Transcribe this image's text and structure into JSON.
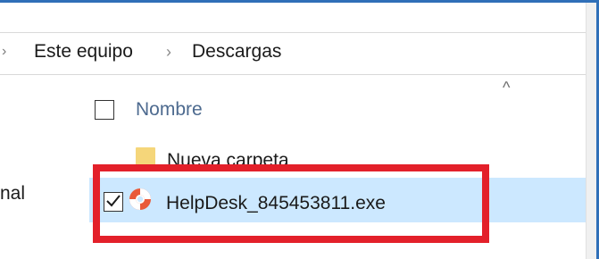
{
  "address_bar": {
    "crumbs": [
      "Este equipo",
      "Descargas"
    ],
    "separator_glyph": "›"
  },
  "nav_pane": {
    "partial_label": "nal"
  },
  "file_list": {
    "column_header": "Nombre",
    "sort_indicator": "^",
    "items": [
      {
        "name": "Nueva carpeta",
        "icon": "folder-icon",
        "selected": false
      },
      {
        "name": "HelpDesk_845453811.exe",
        "icon": "lifebuoy-icon",
        "selected": true,
        "checked": true
      }
    ]
  },
  "colors": {
    "window_border": "#2f6fb8",
    "selection_bg": "#cce8ff",
    "highlight_border": "#e3202a"
  }
}
